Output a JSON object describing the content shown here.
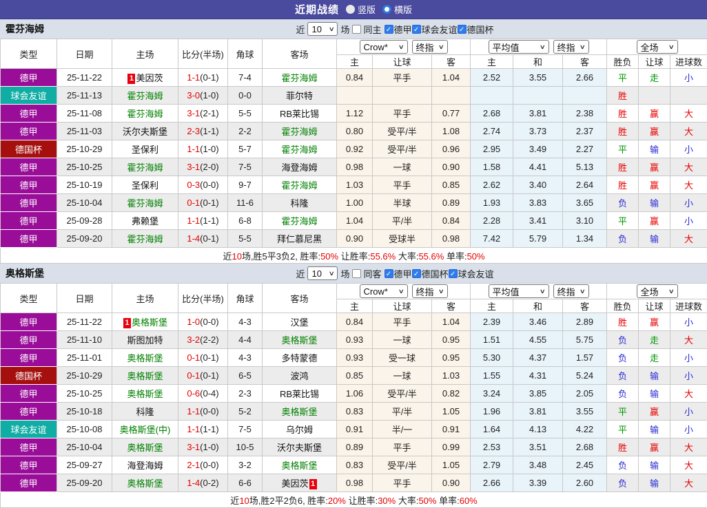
{
  "title_bar": {
    "title": "近期战绩",
    "vertical_label": "竖版",
    "horizontal_label": "横版"
  },
  "colors": {
    "accent_bar": "#4a4a9e",
    "league_purple": "#990d99",
    "friendly_teal": "#10ada4",
    "cup_red": "#a5100f",
    "focus_team_green": "#008000",
    "win_red": "#e60000",
    "draw_green": "#009400",
    "lose_blue": "#2a2ad4"
  },
  "table_columns": {
    "main": [
      "类型",
      "日期",
      "主场",
      "比分(半场)",
      "角球",
      "客场"
    ],
    "odds_source_select": "Crow*",
    "final_index_select": "终指",
    "average_select": "平均值",
    "final_index_select2": "终指",
    "fulltime_select": "全场",
    "sub": [
      "主",
      "让球",
      "客",
      "主",
      "和",
      "客",
      "胜负",
      "让球",
      "进球数"
    ]
  },
  "sections": [
    {
      "team": "霍芬海姆",
      "filters": {
        "near": "近",
        "count": "10",
        "games": "场",
        "same": "同主",
        "leagues": [
          "德甲",
          "球会友谊",
          "德国杯"
        ]
      },
      "rows": [
        {
          "type": "德甲",
          "type_color": "#990d99",
          "date": "25-11-22",
          "home": {
            "name": "美因茨",
            "focus": false,
            "badge": "1",
            "badge_pos": "before"
          },
          "score_ft": "1-1",
          "score_ht": "(0-1)",
          "corners": "7-4",
          "away": {
            "name": "霍芬海姆",
            "focus": true
          },
          "odds": [
            "0.84",
            "平手",
            "1.04"
          ],
          "avg": [
            "2.52",
            "3.55",
            "2.66"
          ],
          "results": [
            {
              "t": "平",
              "c": "g"
            },
            {
              "t": "走",
              "c": "g"
            },
            {
              "t": "小",
              "c": "b"
            }
          ]
        },
        {
          "type": "球会友谊",
          "type_color": "#10ada4",
          "date": "25-11-13",
          "home": {
            "name": "霍芬海姆",
            "focus": true
          },
          "score_ft": "3-0",
          "score_ht": "(1-0)",
          "corners": "0-0",
          "away": {
            "name": "菲尔特",
            "focus": false
          },
          "odds": [
            "",
            "",
            ""
          ],
          "avg": [
            "",
            "",
            ""
          ],
          "results": [
            {
              "t": "胜",
              "c": "r"
            },
            {
              "t": "",
              "c": ""
            },
            {
              "t": "",
              "c": ""
            }
          ]
        },
        {
          "type": "德甲",
          "type_color": "#990d99",
          "date": "25-11-08",
          "home": {
            "name": "霍芬海姆",
            "focus": true
          },
          "score_ft": "3-1",
          "score_ht": "(2-1)",
          "corners": "5-5",
          "away": {
            "name": "RB莱比锡",
            "focus": false
          },
          "odds": [
            "1.12",
            "平手",
            "0.77"
          ],
          "avg": [
            "2.68",
            "3.81",
            "2.38"
          ],
          "results": [
            {
              "t": "胜",
              "c": "r"
            },
            {
              "t": "赢",
              "c": "r"
            },
            {
              "t": "大",
              "c": "r"
            }
          ]
        },
        {
          "type": "德甲",
          "type_color": "#990d99",
          "date": "25-11-03",
          "home": {
            "name": "沃尔夫斯堡",
            "focus": false
          },
          "score_ft": "2-3",
          "score_ht": "(1-1)",
          "corners": "2-2",
          "away": {
            "name": "霍芬海姆",
            "focus": true
          },
          "odds": [
            "0.80",
            "受平/半",
            "1.08"
          ],
          "avg": [
            "2.74",
            "3.73",
            "2.37"
          ],
          "results": [
            {
              "t": "胜",
              "c": "r"
            },
            {
              "t": "赢",
              "c": "r"
            },
            {
              "t": "大",
              "c": "r"
            }
          ]
        },
        {
          "type": "德国杯",
          "type_color": "#a5100f",
          "date": "25-10-29",
          "home": {
            "name": "圣保利",
            "focus": false
          },
          "score_ft": "1-1",
          "score_ht": "(1-0)",
          "corners": "5-7",
          "away": {
            "name": "霍芬海姆",
            "focus": true
          },
          "odds": [
            "0.92",
            "受平/半",
            "0.96"
          ],
          "avg": [
            "2.95",
            "3.49",
            "2.27"
          ],
          "results": [
            {
              "t": "平",
              "c": "g"
            },
            {
              "t": "输",
              "c": "b"
            },
            {
              "t": "小",
              "c": "b"
            }
          ]
        },
        {
          "type": "德甲",
          "type_color": "#990d99",
          "date": "25-10-25",
          "home": {
            "name": "霍芬海姆",
            "focus": true
          },
          "score_ft": "3-1",
          "score_ht": "(2-0)",
          "corners": "7-5",
          "away": {
            "name": "海登海姆",
            "focus": false
          },
          "odds": [
            "0.98",
            "一球",
            "0.90"
          ],
          "avg": [
            "1.58",
            "4.41",
            "5.13"
          ],
          "results": [
            {
              "t": "胜",
              "c": "r"
            },
            {
              "t": "赢",
              "c": "r"
            },
            {
              "t": "大",
              "c": "r"
            }
          ]
        },
        {
          "type": "德甲",
          "type_color": "#990d99",
          "date": "25-10-19",
          "home": {
            "name": "圣保利",
            "focus": false
          },
          "score_ft": "0-3",
          "score_ht": "(0-0)",
          "corners": "9-7",
          "away": {
            "name": "霍芬海姆",
            "focus": true
          },
          "odds": [
            "1.03",
            "平手",
            "0.85"
          ],
          "avg": [
            "2.62",
            "3.40",
            "2.64"
          ],
          "results": [
            {
              "t": "胜",
              "c": "r"
            },
            {
              "t": "赢",
              "c": "r"
            },
            {
              "t": "大",
              "c": "r"
            }
          ]
        },
        {
          "type": "德甲",
          "type_color": "#990d99",
          "date": "25-10-04",
          "home": {
            "name": "霍芬海姆",
            "focus": true
          },
          "score_ft": "0-1",
          "score_ht": "(0-1)",
          "corners": "11-6",
          "away": {
            "name": "科隆",
            "focus": false
          },
          "odds": [
            "1.00",
            "半球",
            "0.89"
          ],
          "avg": [
            "1.93",
            "3.83",
            "3.65"
          ],
          "results": [
            {
              "t": "负",
              "c": "b"
            },
            {
              "t": "输",
              "c": "b"
            },
            {
              "t": "小",
              "c": "b"
            }
          ]
        },
        {
          "type": "德甲",
          "type_color": "#990d99",
          "date": "25-09-28",
          "home": {
            "name": "弗赖堡",
            "focus": false
          },
          "score_ft": "1-1",
          "score_ht": "(1-1)",
          "corners": "6-8",
          "away": {
            "name": "霍芬海姆",
            "focus": true
          },
          "odds": [
            "1.04",
            "平/半",
            "0.84"
          ],
          "avg": [
            "2.28",
            "3.41",
            "3.10"
          ],
          "results": [
            {
              "t": "平",
              "c": "g"
            },
            {
              "t": "赢",
              "c": "r"
            },
            {
              "t": "小",
              "c": "b"
            }
          ]
        },
        {
          "type": "德甲",
          "type_color": "#990d99",
          "date": "25-09-20",
          "home": {
            "name": "霍芬海姆",
            "focus": true
          },
          "score_ft": "1-4",
          "score_ht": "(0-1)",
          "corners": "5-5",
          "away": {
            "name": "拜仁慕尼黑",
            "focus": false
          },
          "odds": [
            "0.90",
            "受球半",
            "0.98"
          ],
          "avg": [
            "7.42",
            "5.79",
            "1.34"
          ],
          "results": [
            {
              "t": "负",
              "c": "b"
            },
            {
              "t": "输",
              "c": "b"
            },
            {
              "t": "大",
              "c": "r"
            }
          ]
        }
      ],
      "summary": [
        {
          "t": "近",
          "c": "d"
        },
        {
          "t": "10",
          "c": "r"
        },
        {
          "t": "场,胜5平3负2, 胜率:",
          "c": "d"
        },
        {
          "t": "50%",
          "c": "r"
        },
        {
          "t": " 让胜率:",
          "c": "d"
        },
        {
          "t": "55.6%",
          "c": "r"
        },
        {
          "t": " 大率:",
          "c": "d"
        },
        {
          "t": "55.6%",
          "c": "r"
        },
        {
          "t": " 单率:",
          "c": "d"
        },
        {
          "t": "50%",
          "c": "r"
        }
      ]
    },
    {
      "team": "奥格斯堡",
      "filters": {
        "near": "近",
        "count": "10",
        "games": "场",
        "same": "同客",
        "leagues": [
          "德甲",
          "德国杯",
          "球会友谊"
        ]
      },
      "rows": [
        {
          "type": "德甲",
          "type_color": "#990d99",
          "date": "25-11-22",
          "home": {
            "name": "奥格斯堡",
            "focus": true,
            "badge": "1",
            "badge_pos": "before"
          },
          "score_ft": "1-0",
          "score_ht": "(0-0)",
          "corners": "4-3",
          "away": {
            "name": "汉堡",
            "focus": false
          },
          "odds": [
            "0.84",
            "平手",
            "1.04"
          ],
          "avg": [
            "2.39",
            "3.46",
            "2.89"
          ],
          "results": [
            {
              "t": "胜",
              "c": "r"
            },
            {
              "t": "赢",
              "c": "r"
            },
            {
              "t": "小",
              "c": "b"
            }
          ]
        },
        {
          "type": "德甲",
          "type_color": "#990d99",
          "date": "25-11-10",
          "home": {
            "name": "斯图加特",
            "focus": false
          },
          "score_ft": "3-2",
          "score_ht": "(2-2)",
          "corners": "4-4",
          "away": {
            "name": "奥格斯堡",
            "focus": true
          },
          "odds": [
            "0.93",
            "一球",
            "0.95"
          ],
          "avg": [
            "1.51",
            "4.55",
            "5.75"
          ],
          "results": [
            {
              "t": "负",
              "c": "b"
            },
            {
              "t": "走",
              "c": "g"
            },
            {
              "t": "大",
              "c": "r"
            }
          ]
        },
        {
          "type": "德甲",
          "type_color": "#990d99",
          "date": "25-11-01",
          "home": {
            "name": "奥格斯堡",
            "focus": true
          },
          "score_ft": "0-1",
          "score_ht": "(0-1)",
          "corners": "4-3",
          "away": {
            "name": "多特蒙德",
            "focus": false
          },
          "odds": [
            "0.93",
            "受一球",
            "0.95"
          ],
          "avg": [
            "5.30",
            "4.37",
            "1.57"
          ],
          "results": [
            {
              "t": "负",
              "c": "b"
            },
            {
              "t": "走",
              "c": "g"
            },
            {
              "t": "小",
              "c": "b"
            }
          ]
        },
        {
          "type": "德国杯",
          "type_color": "#a5100f",
          "date": "25-10-29",
          "home": {
            "name": "奥格斯堡",
            "focus": true
          },
          "score_ft": "0-1",
          "score_ht": "(0-1)",
          "corners": "6-5",
          "away": {
            "name": "波鸿",
            "focus": false
          },
          "odds": [
            "0.85",
            "一球",
            "1.03"
          ],
          "avg": [
            "1.55",
            "4.31",
            "5.24"
          ],
          "results": [
            {
              "t": "负",
              "c": "b"
            },
            {
              "t": "输",
              "c": "b"
            },
            {
              "t": "小",
              "c": "b"
            }
          ]
        },
        {
          "type": "德甲",
          "type_color": "#990d99",
          "date": "25-10-25",
          "home": {
            "name": "奥格斯堡",
            "focus": true
          },
          "score_ft": "0-6",
          "score_ht": "(0-4)",
          "corners": "2-3",
          "away": {
            "name": "RB莱比锡",
            "focus": false
          },
          "odds": [
            "1.06",
            "受平/半",
            "0.82"
          ],
          "avg": [
            "3.24",
            "3.85",
            "2.05"
          ],
          "results": [
            {
              "t": "负",
              "c": "b"
            },
            {
              "t": "输",
              "c": "b"
            },
            {
              "t": "大",
              "c": "r"
            }
          ]
        },
        {
          "type": "德甲",
          "type_color": "#990d99",
          "date": "25-10-18",
          "home": {
            "name": "科隆",
            "focus": false
          },
          "score_ft": "1-1",
          "score_ht": "(0-0)",
          "corners": "5-2",
          "away": {
            "name": "奥格斯堡",
            "focus": true
          },
          "odds": [
            "0.83",
            "平/半",
            "1.05"
          ],
          "avg": [
            "1.96",
            "3.81",
            "3.55"
          ],
          "results": [
            {
              "t": "平",
              "c": "g"
            },
            {
              "t": "赢",
              "c": "r"
            },
            {
              "t": "小",
              "c": "b"
            }
          ]
        },
        {
          "type": "球会友谊",
          "type_color": "#10ada4",
          "date": "25-10-08",
          "home": {
            "name": "奥格斯堡(中)",
            "focus": true
          },
          "score_ft": "1-1",
          "score_ht": "(1-1)",
          "corners": "7-5",
          "away": {
            "name": "乌尔姆",
            "focus": false
          },
          "odds": [
            "0.91",
            "半/一",
            "0.91"
          ],
          "avg": [
            "1.64",
            "4.13",
            "4.22"
          ],
          "results": [
            {
              "t": "平",
              "c": "g"
            },
            {
              "t": "输",
              "c": "b"
            },
            {
              "t": "小",
              "c": "b"
            }
          ]
        },
        {
          "type": "德甲",
          "type_color": "#990d99",
          "date": "25-10-04",
          "home": {
            "name": "奥格斯堡",
            "focus": true
          },
          "score_ft": "3-1",
          "score_ht": "(1-0)",
          "corners": "10-5",
          "away": {
            "name": "沃尔夫斯堡",
            "focus": false
          },
          "odds": [
            "0.89",
            "平手",
            "0.99"
          ],
          "avg": [
            "2.53",
            "3.51",
            "2.68"
          ],
          "results": [
            {
              "t": "胜",
              "c": "r"
            },
            {
              "t": "赢",
              "c": "r"
            },
            {
              "t": "大",
              "c": "r"
            }
          ]
        },
        {
          "type": "德甲",
          "type_color": "#990d99",
          "date": "25-09-27",
          "home": {
            "name": "海登海姆",
            "focus": false
          },
          "score_ft": "2-1",
          "score_ht": "(0-0)",
          "corners": "3-2",
          "away": {
            "name": "奥格斯堡",
            "focus": true
          },
          "odds": [
            "0.83",
            "受平/半",
            "1.05"
          ],
          "avg": [
            "2.79",
            "3.48",
            "2.45"
          ],
          "results": [
            {
              "t": "负",
              "c": "b"
            },
            {
              "t": "输",
              "c": "b"
            },
            {
              "t": "大",
              "c": "r"
            }
          ]
        },
        {
          "type": "德甲",
          "type_color": "#990d99",
          "date": "25-09-20",
          "home": {
            "name": "奥格斯堡",
            "focus": true
          },
          "score_ft": "1-4",
          "score_ht": "(0-2)",
          "corners": "6-6",
          "away": {
            "name": "美因茨",
            "focus": false,
            "badge": "1",
            "badge_pos": "after"
          },
          "odds": [
            "0.98",
            "平手",
            "0.90"
          ],
          "avg": [
            "2.66",
            "3.39",
            "2.60"
          ],
          "results": [
            {
              "t": "负",
              "c": "b"
            },
            {
              "t": "输",
              "c": "b"
            },
            {
              "t": "大",
              "c": "r"
            }
          ]
        }
      ],
      "summary": [
        {
          "t": "近",
          "c": "d"
        },
        {
          "t": "10",
          "c": "r"
        },
        {
          "t": "场,胜2平2负6, 胜率:",
          "c": "d"
        },
        {
          "t": "20%",
          "c": "r"
        },
        {
          "t": " 让胜率:",
          "c": "d"
        },
        {
          "t": "30%",
          "c": "r"
        },
        {
          "t": " 大率:",
          "c": "d"
        },
        {
          "t": "50%",
          "c": "r"
        },
        {
          "t": " 单率:",
          "c": "d"
        },
        {
          "t": "60%",
          "c": "r"
        }
      ]
    }
  ]
}
